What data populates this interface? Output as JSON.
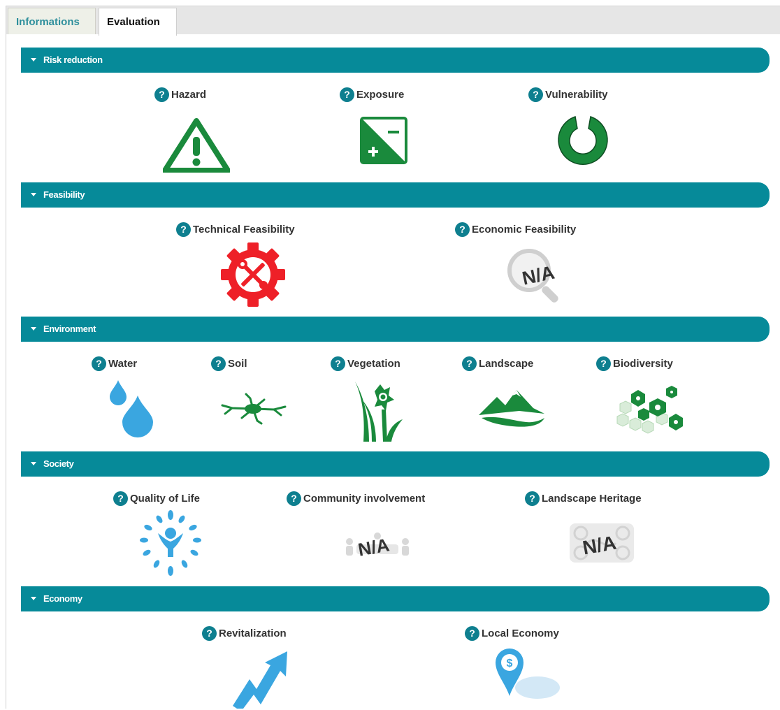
{
  "tabs": [
    {
      "label": "Informations"
    },
    {
      "label": "Evaluation"
    }
  ],
  "help_glyph": "?",
  "na_text": "N/A",
  "colors": {
    "section_bar": "#068a99",
    "help_badge": "#0e7f8f",
    "green": "#1a8a3c",
    "red": "#ee2028",
    "blue": "#3aa6e0"
  },
  "sections": [
    {
      "title": "Risk reduction",
      "criteria": [
        {
          "label": "Hazard",
          "icon": "warning-triangle-icon"
        },
        {
          "label": "Exposure",
          "icon": "plus-minus-square-icon"
        },
        {
          "label": "Vulnerability",
          "icon": "broken-ring-icon"
        }
      ]
    },
    {
      "title": "Feasibility",
      "criteria": [
        {
          "label": "Technical Feasibility",
          "icon": "gear-tools-icon"
        },
        {
          "label": "Economic Feasibility",
          "icon": "magnifier-na-icon"
        }
      ]
    },
    {
      "title": "Environment",
      "criteria": [
        {
          "label": "Water",
          "icon": "water-drops-icon"
        },
        {
          "label": "Soil",
          "icon": "cracked-soil-icon"
        },
        {
          "label": "Vegetation",
          "icon": "flower-plant-icon"
        },
        {
          "label": "Landscape",
          "icon": "mountain-icon"
        },
        {
          "label": "Biodiversity",
          "icon": "biodiversity-hexagons-icon"
        }
      ]
    },
    {
      "title": "Society",
      "criteria": [
        {
          "label": "Quality of Life",
          "icon": "person-leaves-icon"
        },
        {
          "label": "Community involvement",
          "icon": "community-na-icon"
        },
        {
          "label": "Landscape Heritage",
          "icon": "heritage-na-icon"
        }
      ]
    },
    {
      "title": "Economy",
      "criteria": [
        {
          "label": "Revitalization",
          "icon": "rising-arrow-icon"
        },
        {
          "label": "Local Economy",
          "icon": "dollar-pin-icon"
        }
      ]
    }
  ]
}
